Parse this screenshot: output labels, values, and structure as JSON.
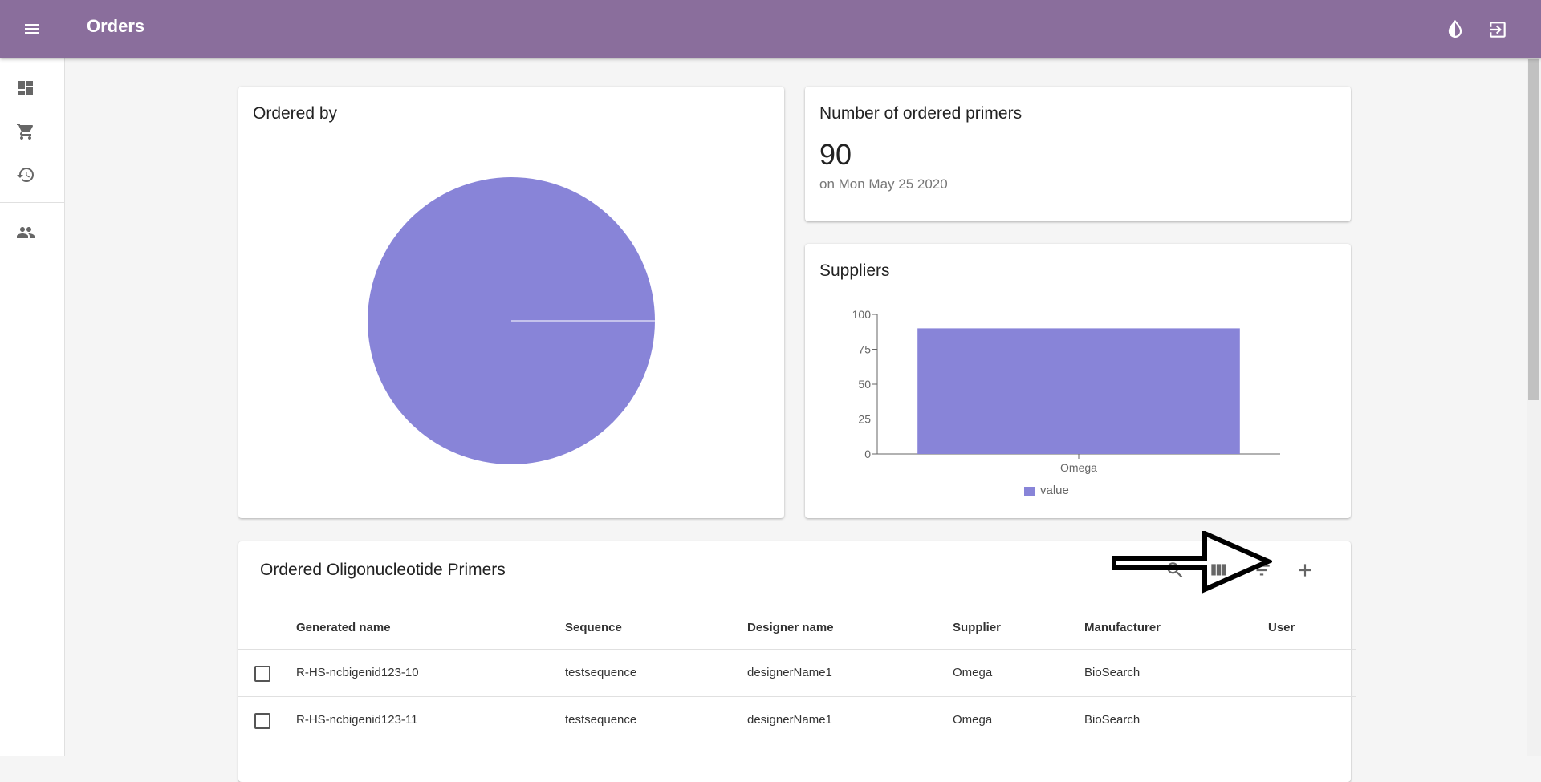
{
  "appbar": {
    "title": "Orders",
    "icons": [
      "menu-icon",
      "theme-toggle-icon",
      "logout-icon"
    ]
  },
  "sidebar": {
    "items": [
      {
        "icon": "dashboard-icon"
      },
      {
        "icon": "cart-icon"
      },
      {
        "icon": "history-icon"
      },
      {
        "icon": "people-icon"
      }
    ]
  },
  "colors": {
    "appbar": "#8a6e9c",
    "accent": "#8884d8"
  },
  "ordered_by": {
    "title": "Ordered by"
  },
  "primer_count": {
    "title": "Number of ordered primers",
    "value": "90",
    "subtitle": "on Mon May 25 2020"
  },
  "suppliers": {
    "title": "Suppliers",
    "legend": "value"
  },
  "chart_data": [
    {
      "type": "pie",
      "title": "Ordered by",
      "slices": [
        {
          "value": 90
        }
      ]
    },
    {
      "type": "bar",
      "title": "Suppliers",
      "categories": [
        "Omega"
      ],
      "series": [
        {
          "name": "value",
          "values": [
            90
          ]
        }
      ],
      "yticks": [
        "0",
        "25",
        "50",
        "75",
        "100"
      ],
      "ylim": [
        0,
        100
      ],
      "legend": "bottom"
    }
  ],
  "table": {
    "title": "Ordered Oligonucleotide Primers",
    "toolbar_icons": [
      "search-icon",
      "view-column-icon",
      "filter-icon",
      "add-icon"
    ],
    "columns": [
      "Generated name",
      "Sequence",
      "Designer name",
      "Supplier",
      "Manufacturer",
      "User"
    ],
    "rows": [
      [
        "R-HS-ncbigenid123-10",
        "testsequence",
        "designerName1",
        "Omega",
        "BioSearch",
        ""
      ],
      [
        "R-HS-ncbigenid123-11",
        "testsequence",
        "designerName1",
        "Omega",
        "BioSearch",
        ""
      ]
    ]
  }
}
